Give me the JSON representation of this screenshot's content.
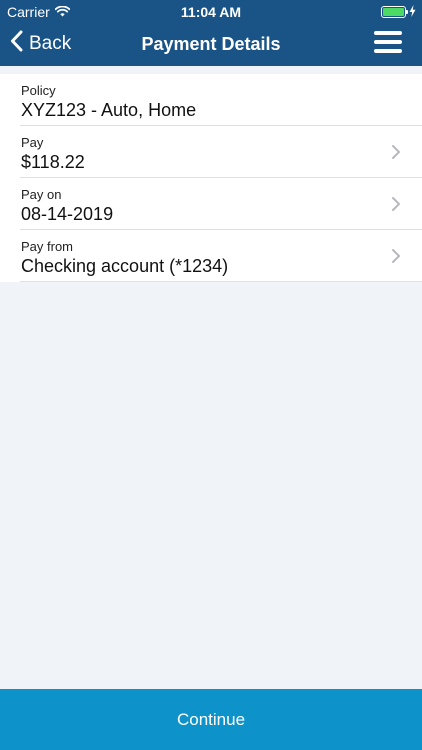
{
  "status_bar": {
    "carrier": "Carrier",
    "time": "11:04 AM",
    "battery_level": 1.0
  },
  "nav": {
    "back_label": "Back",
    "title": "Payment Details"
  },
  "rows": [
    {
      "label": "Policy",
      "value": "XYZ123 - Auto, Home",
      "has_chevron": false
    },
    {
      "label": "Pay",
      "value": "$118.22",
      "has_chevron": true
    },
    {
      "label": "Pay on",
      "value": "08-14-2019",
      "has_chevron": true
    },
    {
      "label": "Pay from",
      "value": "Checking account (*1234)",
      "has_chevron": true
    }
  ],
  "footer": {
    "continue_label": "Continue"
  },
  "colors": {
    "header_bg": "#1a5385",
    "accent": "#0d93c9",
    "battery": "#4cd964"
  }
}
